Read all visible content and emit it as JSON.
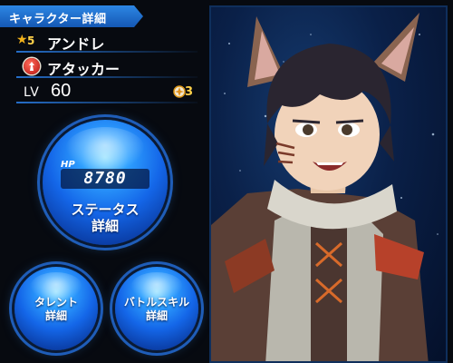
{
  "header": {
    "title": "キャラクター詳細"
  },
  "character": {
    "rarity": "5",
    "name": "アンドレ",
    "role": "アタッカー",
    "level_label": "LV",
    "level": "60",
    "limit_break": "3",
    "hp_label": "HP",
    "hp": "8780"
  },
  "buttons": {
    "status": [
      "ステータス",
      "詳細"
    ],
    "talent": [
      "タレント",
      "詳細"
    ],
    "battle_skill": [
      "バトルスキル",
      "詳細"
    ]
  },
  "colors": {
    "accent": "#1f6fd6",
    "orb": "#1466e8",
    "rarity": "#f2b21a",
    "role": "#d02a1e"
  }
}
